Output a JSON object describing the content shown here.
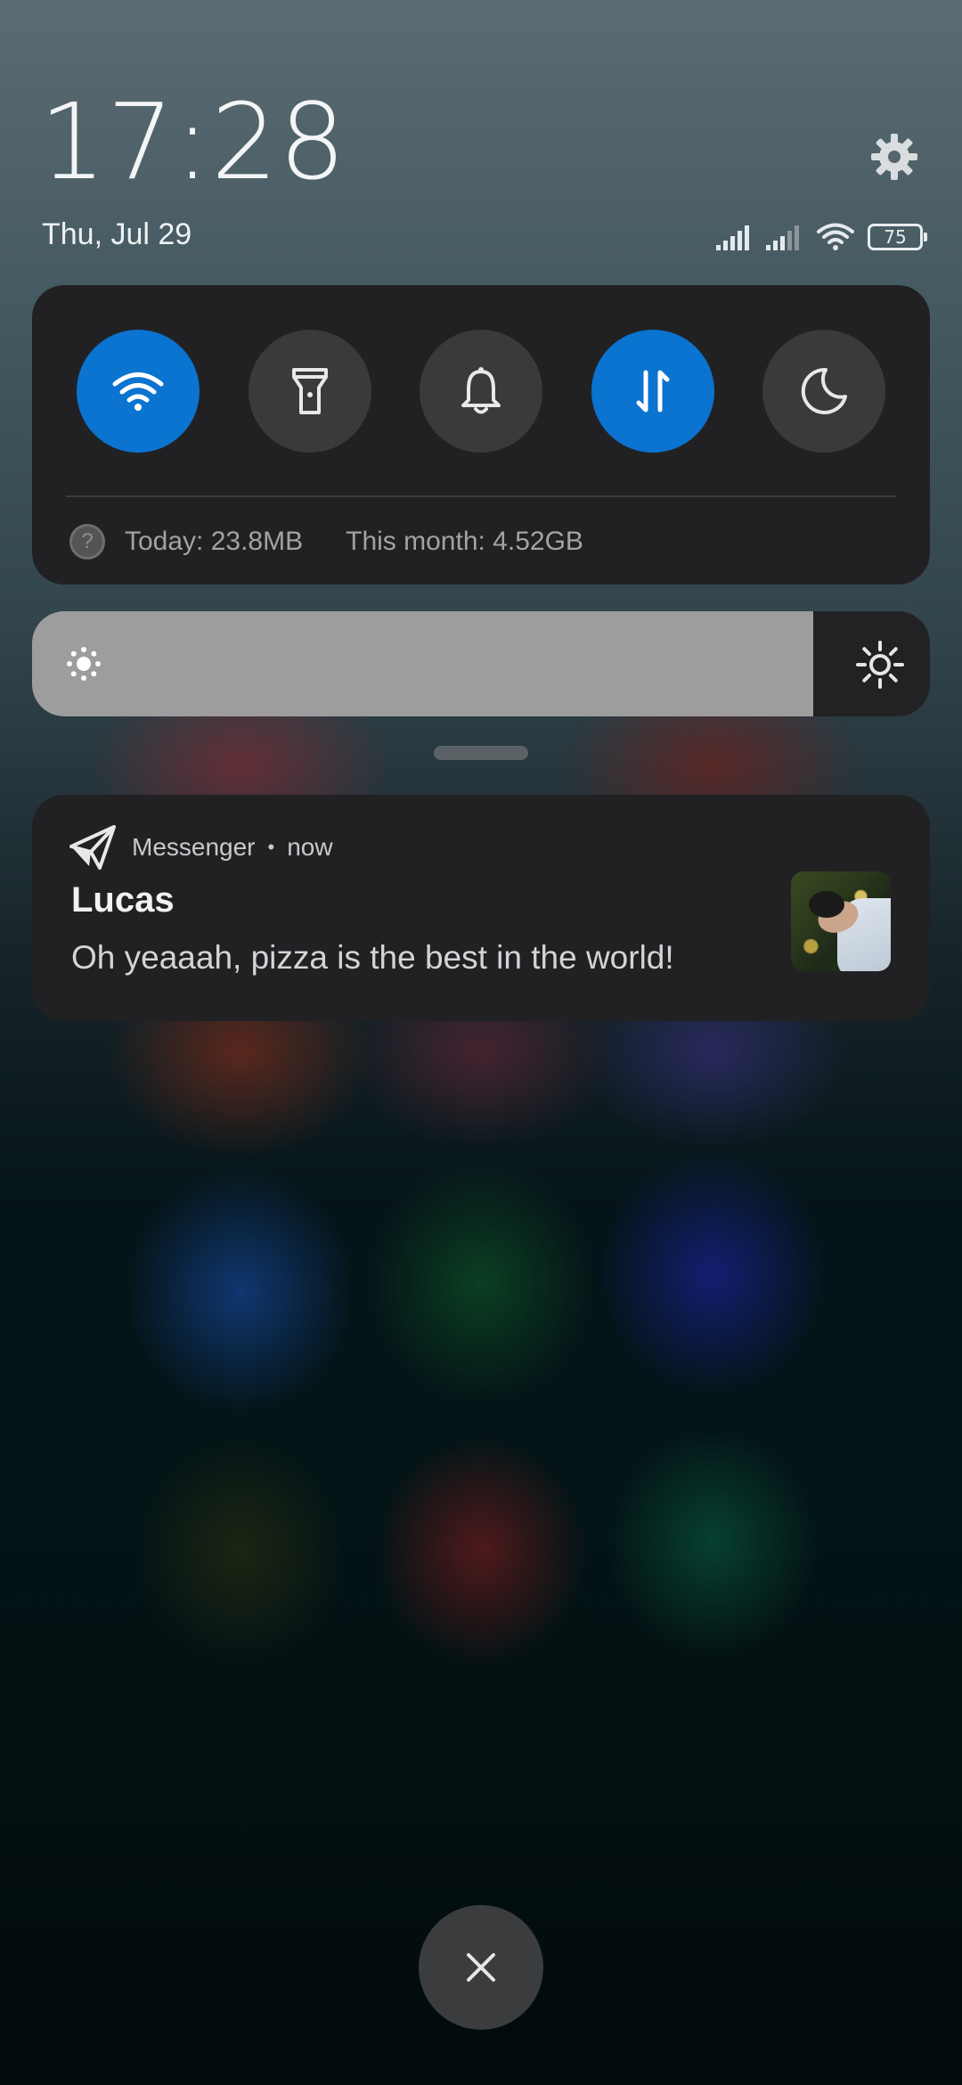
{
  "header": {
    "time": "17:28",
    "date": "Thu, Jul 29",
    "battery_level": "75",
    "settings_icon": "gear-icon",
    "status_icons": [
      "cellular-signal-1-icon",
      "cellular-signal-2-icon",
      "wifi-icon",
      "battery-icon"
    ]
  },
  "quick_settings": {
    "toggles": [
      {
        "icon": "wifi-icon",
        "active": true
      },
      {
        "icon": "flashlight-icon",
        "active": false
      },
      {
        "icon": "bell-icon",
        "active": false
      },
      {
        "icon": "mobile-data-icon",
        "active": true
      },
      {
        "icon": "moon-icon",
        "active": false
      }
    ],
    "data_usage": {
      "help_symbol": "?",
      "today": "Today: 23.8MB",
      "month": "This month: 4.52GB"
    }
  },
  "brightness": {
    "level": 0.87,
    "low_icon": "brightness-low-icon",
    "high_icon": "brightness-high-icon"
  },
  "notification": {
    "app_icon": "paper-plane-icon",
    "app_name": "Messenger",
    "separator": "•",
    "time": "now",
    "title": "Lucas",
    "body": "Oh yeaaah, pizza is the best in the world!"
  },
  "clear_button": {
    "icon": "close-icon"
  },
  "colors": {
    "accent": "#0b73d0",
    "panel": "#212124",
    "toggle_inactive": "#3a3a3d"
  }
}
